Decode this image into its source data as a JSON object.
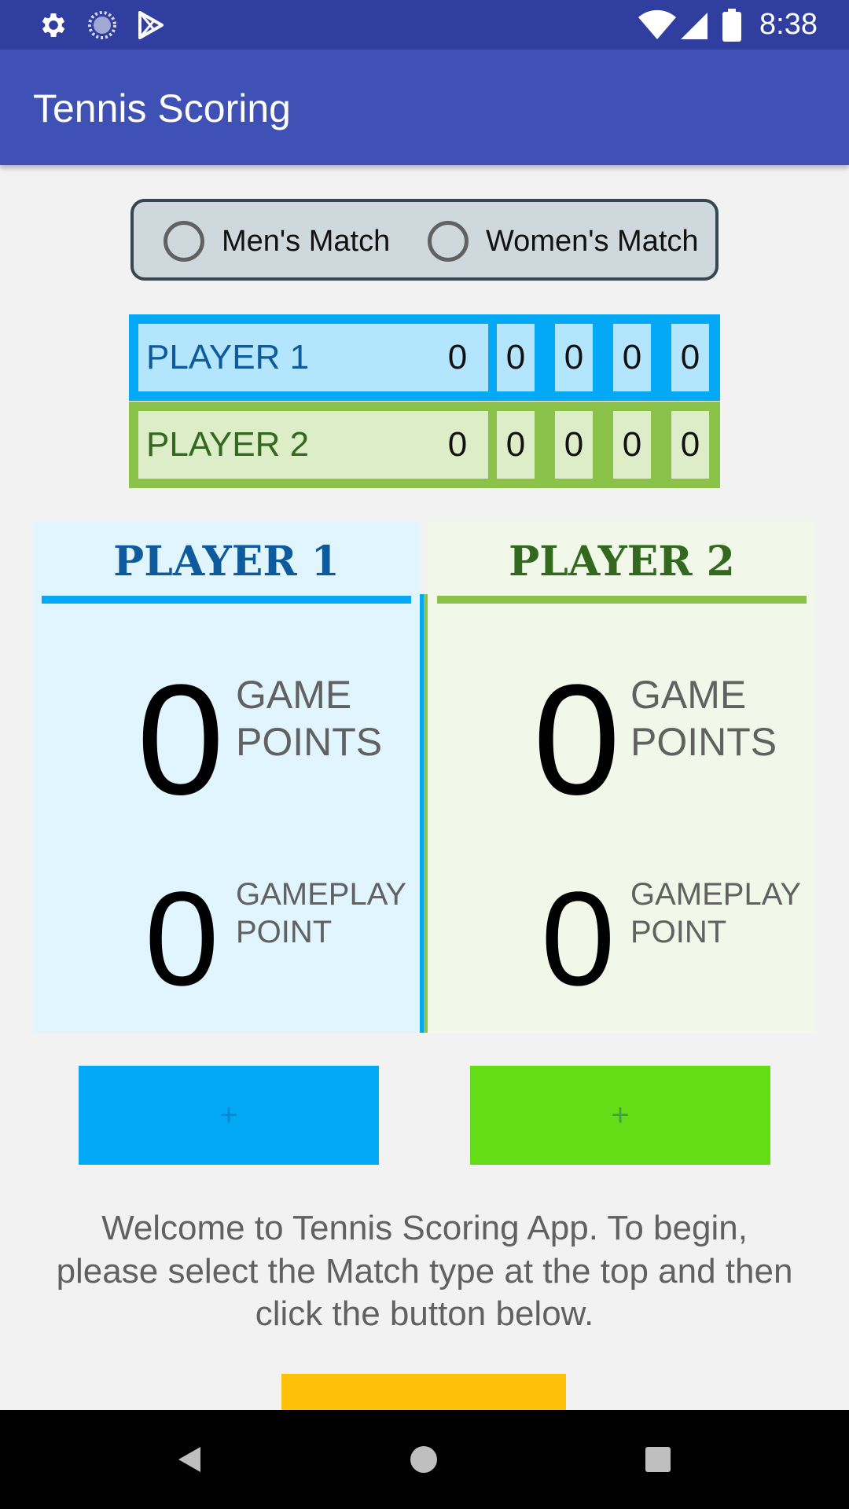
{
  "status_bar": {
    "time": "8:38",
    "left_icons": [
      "settings-icon",
      "sync-icon",
      "play-store-icon"
    ],
    "right_icons": [
      "wifi-icon",
      "signal-icon",
      "battery-icon"
    ]
  },
  "app_bar": {
    "title": "Tennis Scoring"
  },
  "match_type": {
    "options": [
      {
        "label": "Men's Match",
        "selected": false
      },
      {
        "label": "Women's Match",
        "selected": false
      }
    ]
  },
  "scoreboard": {
    "player1": {
      "name": "PLAYER 1",
      "games": "0",
      "sets": [
        "0",
        "0",
        "0",
        "0",
        "0"
      ]
    },
    "player2": {
      "name": "PLAYER 2",
      "games": "0",
      "sets": [
        "0",
        "0",
        "0",
        "0",
        "0"
      ]
    }
  },
  "panels": {
    "player1": {
      "title": "PLAYER 1",
      "game_points": "0",
      "game_points_label": "GAME POINTS",
      "gameplay_point": "0",
      "gameplay_point_label": "GAMEPLAY POINT"
    },
    "player2": {
      "title": "PLAYER 2",
      "game_points": "0",
      "game_points_label": "GAME POINTS",
      "gameplay_point": "0",
      "gameplay_point_label": "GAMEPLAY POINT"
    }
  },
  "buttons": {
    "player1_plus": "+",
    "player2_plus": "+"
  },
  "welcome_text": "Welcome to Tennis Scoring App. To begin, please select the Match type at the top and then click the button below.",
  "colors": {
    "status_bar": "#303F9F",
    "app_bar": "#3F51B5",
    "player1": "#03A9F4",
    "player2": "#8BC34A",
    "player2_button": "#64DD17",
    "start_button": "#FFC107"
  }
}
